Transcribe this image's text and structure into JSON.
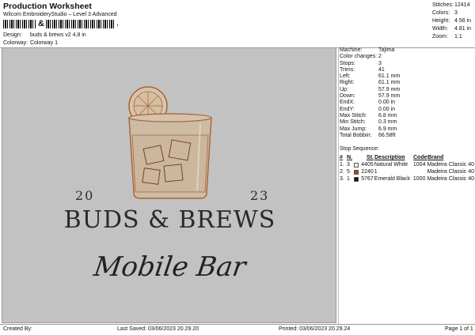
{
  "header": {
    "title": "Production Worksheet",
    "software": "Wilcom EmbroideryStudio – Level 3 Advanced",
    "design_label": "Design:",
    "design_value": "buds & brews v2 4,8 in",
    "colorway_label": "Colorway:",
    "colorway_value": "Colorway 1"
  },
  "stats": [
    {
      "k": "Stitches:",
      "v": "12414"
    },
    {
      "k": "Colors:",
      "v": "3"
    },
    {
      "k": "Height:",
      "v": "4.56 in"
    },
    {
      "k": "Width:",
      "v": "4.81 in"
    },
    {
      "k": "Zoom:",
      "v": "1:1"
    }
  ],
  "preview": {
    "year_left": "20",
    "year_right": "23",
    "brand_text": "BUDS & BREWS",
    "tagline": "Mobile Bar",
    "background": "#c2c2c2",
    "thread_color": "#a8623a"
  },
  "machine": [
    {
      "k": "Machine:",
      "v": "Tajima"
    },
    {
      "k": "Color changes:",
      "v": "2"
    },
    {
      "k": "Stops:",
      "v": "3"
    },
    {
      "k": "Trims:",
      "v": "41"
    },
    {
      "k": "Left:",
      "v": "61.1 mm"
    },
    {
      "k": "Right:",
      "v": "61.1 mm"
    },
    {
      "k": "Up:",
      "v": "57.9 mm"
    },
    {
      "k": "Down:",
      "v": "57.9 mm"
    },
    {
      "k": "EndX:",
      "v": "0.00 in"
    },
    {
      "k": "EndY:",
      "v": "0.00 in"
    },
    {
      "k": "Max Stitch:",
      "v": "6.8 mm"
    },
    {
      "k": "Min Stitch:",
      "v": "0.3 mm"
    },
    {
      "k": "Max Jump:",
      "v": "6.9 mm"
    },
    {
      "k": "Total Bobbin:",
      "v": "66.58ft"
    }
  ],
  "sequence": {
    "label": "Stop Sequence:",
    "headers": {
      "n": "#",
      "s": "N.",
      "st": "St.",
      "d": "Description",
      "c": "Code",
      "b": "Brand"
    },
    "rows": [
      {
        "n": "1.",
        "s": "3",
        "swatch": "#f2efe6",
        "st": "4405",
        "d": "Natural White",
        "c": "1004",
        "b": "Madeira Classic 40"
      },
      {
        "n": "2.",
        "s": "5",
        "swatch": "#a04a2c",
        "st": "2240",
        "d": "1",
        "c": "",
        "b": "Madeira Classic 40"
      },
      {
        "n": "3.",
        "s": "1",
        "swatch": "#151515",
        "st": "5767",
        "d": "Emerald Black",
        "c": "1000",
        "b": "Madeira Classic 40"
      }
    ]
  },
  "footer": {
    "created_by": "Created By:",
    "last_saved": "Last Saved: 03/06/2023 20.29.20",
    "printed": "Printed: 03/06/2023 20.29.24",
    "page": "Page 1 of 1"
  }
}
